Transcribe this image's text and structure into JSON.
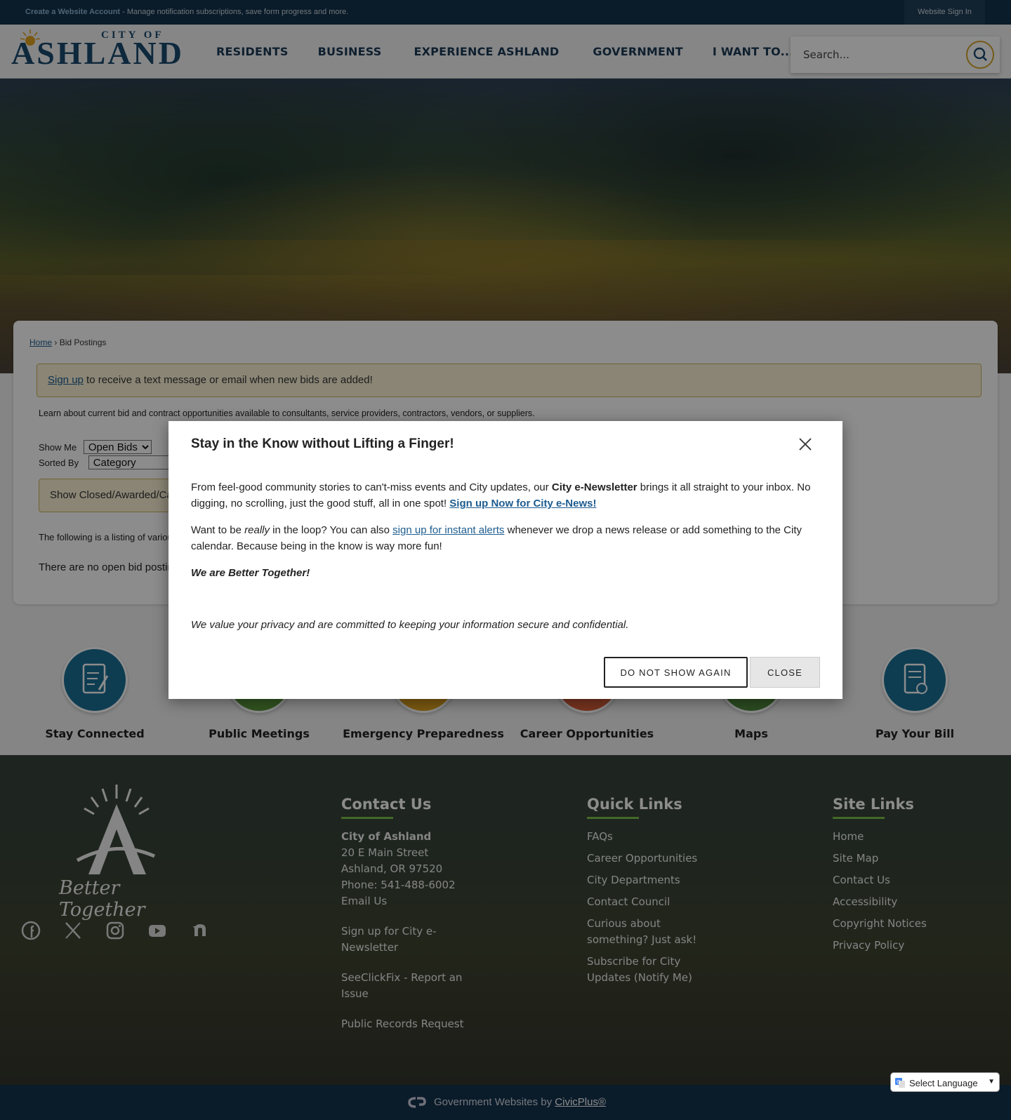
{
  "topbar": {
    "create_account": "Create a Website Account",
    "create_account_desc": " - Manage notification subscriptions, save form progress and more.",
    "sign_in": "Website Sign In"
  },
  "header": {
    "logo_top": "CITY OF",
    "logo_name": "ASHLAND",
    "nav": [
      "RESIDENTS",
      "BUSINESS",
      "EXPERIENCE ASHLAND",
      "GOVERNMENT",
      "I WANT TO..."
    ],
    "search_placeholder": "Search..."
  },
  "content": {
    "breadcrumb_home": "Home",
    "breadcrumb_sep": " › ",
    "breadcrumb_current": "Bid Postings",
    "alert_link": "Sign up",
    "alert_text": " to receive a text message or email when new bids are added!",
    "intro": "Learn about current bid and contract opportunities available to consultants, service providers, contractors, vendors, or suppliers.",
    "show_me_label": "Show Me",
    "show_me_value": "Open Bids",
    "sorted_by_label": "Sorted By",
    "sorted_by_value": "Category",
    "closed_button": "Show Closed/Awarded/Cancelled Bids",
    "listing_text": "The following is a listing of various bid opportunities.",
    "no_open": "There are no open bid postings at this time."
  },
  "quick_links": [
    {
      "label": "Stay Connected",
      "color": "#1a6f95"
    },
    {
      "label": "Public Meetings",
      "color": "#5a9a3a"
    },
    {
      "label": "Emergency Preparedness",
      "color": "#e0a21e"
    },
    {
      "label": "Career Opportunities",
      "color": "#d9603a"
    },
    {
      "label": "Maps",
      "color": "#4f8a3c"
    },
    {
      "label": "Pay Your Bill",
      "color": "#1a6f95"
    }
  ],
  "modal": {
    "title": "Stay in the Know without Lifting a Finger!",
    "p1_a": "From feel-good community stories to can't-miss events and City updates, our ",
    "p1_bold": "City e-Newsletter",
    "p1_b": " brings it all straight to your inbox. No digging, no scrolling, just the good stuff, all in one spot! ",
    "p1_link": "Sign up Now for City e-News!",
    "p2_a": "Want to be ",
    "p2_em": "really",
    "p2_b": " in the loop? You can also ",
    "p2_link": "sign up for instant alerts",
    "p2_c": " whenever we drop a news release or add something to the City calendar. Because being in the know is way more fun!",
    "p3": "We are Better Together!",
    "privacy": "We value your privacy and are committed to keeping your information secure and confidential.",
    "btn_dont_show": "DO NOT SHOW AGAIN",
    "btn_close": "CLOSE"
  },
  "footer": {
    "tagline": "Better Together",
    "social": [
      "facebook-icon",
      "x-icon",
      "instagram-icon",
      "youtube-icon",
      "nextdoor-icon"
    ],
    "contact": {
      "title": "Contact Us",
      "org": "City of Ashland",
      "address1": "20 E Main Street",
      "address2": "Ashland, OR 97520",
      "phone": "Phone: 541-488-6002",
      "email": "Email Us",
      "link1": "Sign up for City e-Newsletter",
      "link2": "SeeClickFix - Report an Issue",
      "link3": "Public Records Request"
    },
    "quick": {
      "title": "Quick Links",
      "items": [
        "FAQs",
        "Career Opportunities",
        "City Departments",
        "Contact Council",
        "Curious about something? Just ask!",
        "Subscribe for City Updates (Notify Me)"
      ]
    },
    "site": {
      "title": "Site Links",
      "items": [
        "Home",
        "Site Map",
        "Contact Us",
        "Accessibility",
        "Copyright Notices",
        "Privacy Policy"
      ]
    }
  },
  "bottom": {
    "text": "Government Websites by ",
    "link": "CivicPlus®"
  },
  "translate": {
    "label": "Select Language"
  }
}
